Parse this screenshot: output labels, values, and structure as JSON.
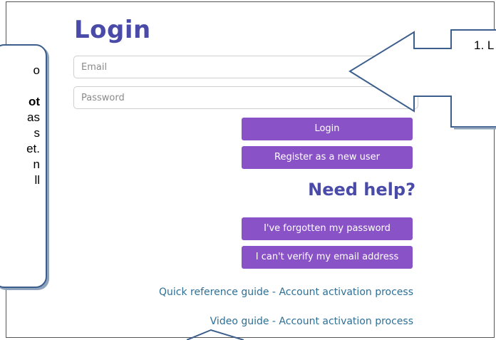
{
  "login": {
    "title": "Login",
    "email_placeholder": "Email",
    "password_placeholder": "Password",
    "login_button": "Login",
    "register_button": "Register as a new user"
  },
  "help": {
    "title": "Need help?",
    "forgot_button": "I've forgotten my password",
    "verify_button": "I can't verify my email address",
    "quick_guide_link": "Quick reference guide - Account activation process",
    "video_guide_link": "Video guide - Account activation process"
  },
  "callouts": {
    "left": {
      "line1": "o",
      "line2": "",
      "line3_bold": "ot",
      "line4": "as",
      "line5": "s",
      "line6": "et.",
      "line7": "n",
      "line8": "ll"
    },
    "right_text": "1. L"
  },
  "colors": {
    "accent_purple": "#8a52c7",
    "heading_blue": "#4a4aa8",
    "link_blue": "#2e6f96",
    "callout_border": "#3c5e8c"
  }
}
